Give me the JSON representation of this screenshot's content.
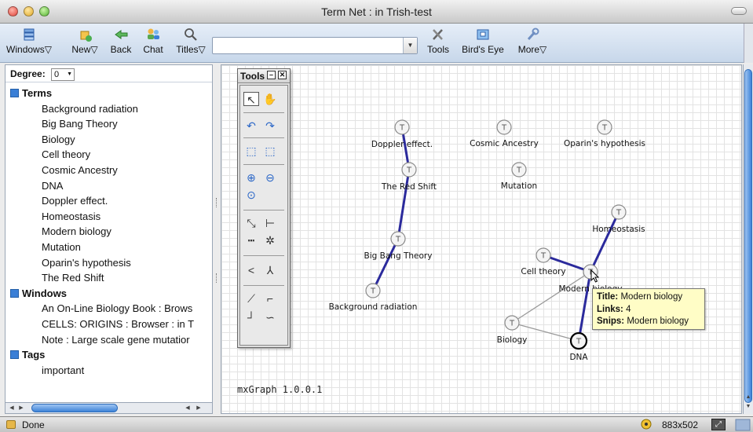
{
  "window": {
    "title": "Term Net : in Trish-test"
  },
  "toolbar": {
    "windows": "Windows",
    "new": "New",
    "back": "Back",
    "chat": "Chat",
    "titles": "Titles",
    "search_value": "",
    "tools": "Tools",
    "birds_eye": "Bird's Eye",
    "more": "More"
  },
  "sidebar": {
    "degree_label": "Degree:",
    "degree_value": "0",
    "groups": [
      {
        "label": "Terms",
        "items": [
          "Background radiation",
          "Big Bang Theory",
          "Biology",
          "Cell theory",
          "Cosmic Ancestry",
          "DNA",
          "Doppler effect.",
          "Homeostasis",
          "Modern biology",
          "Mutation",
          "Oparin's hypothesis",
          "The Red Shift"
        ]
      },
      {
        "label": "Windows",
        "items": [
          "An On-Line Biology Book : Brows",
          "CELLS: ORIGINS : Browser : in T",
          "Note : Large scale gene mutatior"
        ]
      },
      {
        "label": "Tags",
        "items": [
          "important"
        ]
      }
    ]
  },
  "tools_palette": {
    "title": "Tools"
  },
  "graph": {
    "version": "mxGraph 1.0.0.1",
    "node_glyph": "T",
    "nodes": [
      {
        "id": "doppler",
        "label": "Doppler effect."
      },
      {
        "id": "redshift",
        "label": "The Red Shift"
      },
      {
        "id": "bigbang",
        "label": "Big Bang Theory"
      },
      {
        "id": "background",
        "label": "Background radiation"
      },
      {
        "id": "cosmic",
        "label": "Cosmic Ancestry"
      },
      {
        "id": "oparin",
        "label": "Oparin's hypothesis"
      },
      {
        "id": "mutation",
        "label": "Mutation"
      },
      {
        "id": "homeostasis",
        "label": "Homeostasis"
      },
      {
        "id": "cell",
        "label": "Cell theory"
      },
      {
        "id": "modern",
        "label": "Modern biology"
      },
      {
        "id": "biology",
        "label": "Biology"
      },
      {
        "id": "dna",
        "label": "DNA"
      }
    ],
    "edges": [
      {
        "from": "doppler",
        "to": "redshift",
        "strong": true
      },
      {
        "from": "redshift",
        "to": "bigbang",
        "strong": true
      },
      {
        "from": "bigbang",
        "to": "background",
        "strong": true
      },
      {
        "from": "homeostasis",
        "to": "modern",
        "strong": true
      },
      {
        "from": "cell",
        "to": "modern",
        "strong": true
      },
      {
        "from": "modern",
        "to": "dna",
        "strong": true
      },
      {
        "from": "modern",
        "to": "biology",
        "strong": false
      },
      {
        "from": "biology",
        "to": "dna",
        "strong": false
      }
    ],
    "edge_color": "#2b2a9c",
    "tooltip": {
      "title_label": "Title:",
      "title_value": "Modern biology",
      "links_label": "Links:",
      "links_value": "4",
      "snips_label": "Snips:",
      "snips_value": "Modern biology"
    }
  },
  "status": {
    "text": "Done",
    "size": "883x502"
  }
}
